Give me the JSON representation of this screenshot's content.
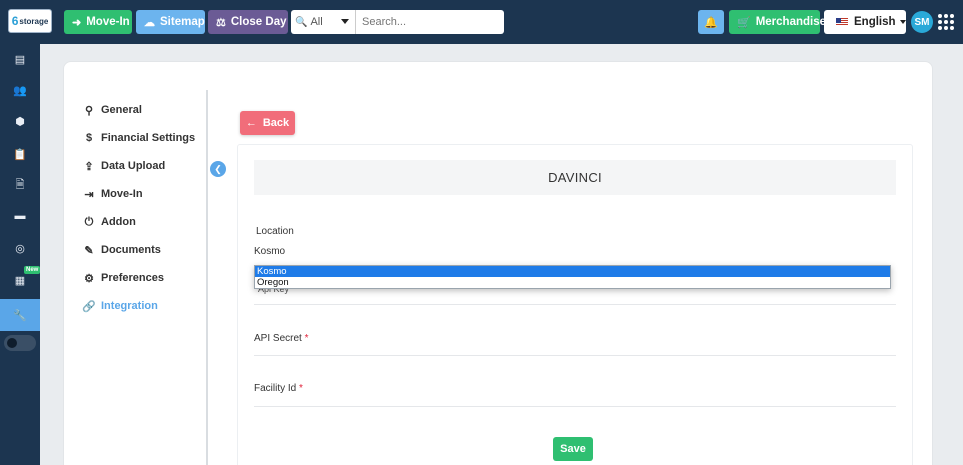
{
  "header": {
    "logo_text": "storage",
    "movein_label": "Move-In",
    "sitemap_label": "Sitemap",
    "closeday_label": "Close Day",
    "search_scope": "All",
    "search_placeholder": "Search...",
    "merchandise_label": "Merchandise",
    "language_label": "English",
    "avatar_initials": "SM"
  },
  "sidebar": {
    "icons": [
      "dashboard-icon",
      "users-icon",
      "units-icon",
      "clipboard-icon",
      "document-icon",
      "payment-icon",
      "marketing-icon",
      "calculator-icon",
      "settings-wrench-icon"
    ],
    "new_badge": "New"
  },
  "settings_nav": {
    "items": [
      {
        "label": "General",
        "icon": "general-icon"
      },
      {
        "label": "Financial Settings",
        "icon": "dollar-icon"
      },
      {
        "label": "Data Upload",
        "icon": "upload-icon"
      },
      {
        "label": "Move-In",
        "icon": "move-in-icon"
      },
      {
        "label": "Addon",
        "icon": "addon-icon"
      },
      {
        "label": "Documents",
        "icon": "documents-icon"
      },
      {
        "label": "Preferences",
        "icon": "gear-icon"
      },
      {
        "label": "Integration",
        "icon": "link-icon"
      }
    ],
    "active": "Integration"
  },
  "back_label": "Back",
  "panel": {
    "title": "DAVINCI",
    "location_label": "Location",
    "location_value": "Kosmo",
    "location_options": [
      "Kosmo",
      "Oregon"
    ],
    "api_key_label_partial": "Api Key",
    "api_secret_label": "API Secret",
    "facility_id_label": "Facility Id",
    "required_mark": "*",
    "save_label": "Save"
  },
  "colors": {
    "topbar": "#1c3550",
    "green": "#2fbf71",
    "blue": "#6cb4ee",
    "purple": "#6b5b95",
    "back_red": "#f16d7a",
    "active_blue": "#5aa6e8"
  }
}
